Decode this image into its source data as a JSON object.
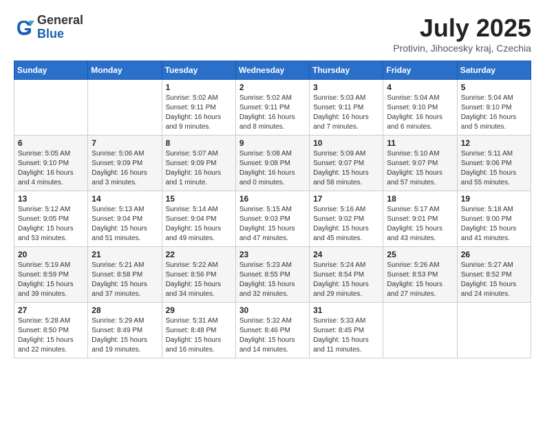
{
  "header": {
    "logo_general": "General",
    "logo_blue": "Blue",
    "month_title": "July 2025",
    "location": "Protivin, Jihocesky kraj, Czechia"
  },
  "days_of_week": [
    "Sunday",
    "Monday",
    "Tuesday",
    "Wednesday",
    "Thursday",
    "Friday",
    "Saturday"
  ],
  "weeks": [
    [
      {
        "day": "",
        "info": ""
      },
      {
        "day": "",
        "info": ""
      },
      {
        "day": "1",
        "info": "Sunrise: 5:02 AM\nSunset: 9:11 PM\nDaylight: 16 hours and 9 minutes."
      },
      {
        "day": "2",
        "info": "Sunrise: 5:02 AM\nSunset: 9:11 PM\nDaylight: 16 hours and 8 minutes."
      },
      {
        "day": "3",
        "info": "Sunrise: 5:03 AM\nSunset: 9:11 PM\nDaylight: 16 hours and 7 minutes."
      },
      {
        "day": "4",
        "info": "Sunrise: 5:04 AM\nSunset: 9:10 PM\nDaylight: 16 hours and 6 minutes."
      },
      {
        "day": "5",
        "info": "Sunrise: 5:04 AM\nSunset: 9:10 PM\nDaylight: 16 hours and 5 minutes."
      }
    ],
    [
      {
        "day": "6",
        "info": "Sunrise: 5:05 AM\nSunset: 9:10 PM\nDaylight: 16 hours and 4 minutes."
      },
      {
        "day": "7",
        "info": "Sunrise: 5:06 AM\nSunset: 9:09 PM\nDaylight: 16 hours and 3 minutes."
      },
      {
        "day": "8",
        "info": "Sunrise: 5:07 AM\nSunset: 9:09 PM\nDaylight: 16 hours and 1 minute."
      },
      {
        "day": "9",
        "info": "Sunrise: 5:08 AM\nSunset: 9:08 PM\nDaylight: 16 hours and 0 minutes."
      },
      {
        "day": "10",
        "info": "Sunrise: 5:09 AM\nSunset: 9:07 PM\nDaylight: 15 hours and 58 minutes."
      },
      {
        "day": "11",
        "info": "Sunrise: 5:10 AM\nSunset: 9:07 PM\nDaylight: 15 hours and 57 minutes."
      },
      {
        "day": "12",
        "info": "Sunrise: 5:11 AM\nSunset: 9:06 PM\nDaylight: 15 hours and 55 minutes."
      }
    ],
    [
      {
        "day": "13",
        "info": "Sunrise: 5:12 AM\nSunset: 9:05 PM\nDaylight: 15 hours and 53 minutes."
      },
      {
        "day": "14",
        "info": "Sunrise: 5:13 AM\nSunset: 9:04 PM\nDaylight: 15 hours and 51 minutes."
      },
      {
        "day": "15",
        "info": "Sunrise: 5:14 AM\nSunset: 9:04 PM\nDaylight: 15 hours and 49 minutes."
      },
      {
        "day": "16",
        "info": "Sunrise: 5:15 AM\nSunset: 9:03 PM\nDaylight: 15 hours and 47 minutes."
      },
      {
        "day": "17",
        "info": "Sunrise: 5:16 AM\nSunset: 9:02 PM\nDaylight: 15 hours and 45 minutes."
      },
      {
        "day": "18",
        "info": "Sunrise: 5:17 AM\nSunset: 9:01 PM\nDaylight: 15 hours and 43 minutes."
      },
      {
        "day": "19",
        "info": "Sunrise: 5:18 AM\nSunset: 9:00 PM\nDaylight: 15 hours and 41 minutes."
      }
    ],
    [
      {
        "day": "20",
        "info": "Sunrise: 5:19 AM\nSunset: 8:59 PM\nDaylight: 15 hours and 39 minutes."
      },
      {
        "day": "21",
        "info": "Sunrise: 5:21 AM\nSunset: 8:58 PM\nDaylight: 15 hours and 37 minutes."
      },
      {
        "day": "22",
        "info": "Sunrise: 5:22 AM\nSunset: 8:56 PM\nDaylight: 15 hours and 34 minutes."
      },
      {
        "day": "23",
        "info": "Sunrise: 5:23 AM\nSunset: 8:55 PM\nDaylight: 15 hours and 32 minutes."
      },
      {
        "day": "24",
        "info": "Sunrise: 5:24 AM\nSunset: 8:54 PM\nDaylight: 15 hours and 29 minutes."
      },
      {
        "day": "25",
        "info": "Sunrise: 5:26 AM\nSunset: 8:53 PM\nDaylight: 15 hours and 27 minutes."
      },
      {
        "day": "26",
        "info": "Sunrise: 5:27 AM\nSunset: 8:52 PM\nDaylight: 15 hours and 24 minutes."
      }
    ],
    [
      {
        "day": "27",
        "info": "Sunrise: 5:28 AM\nSunset: 8:50 PM\nDaylight: 15 hours and 22 minutes."
      },
      {
        "day": "28",
        "info": "Sunrise: 5:29 AM\nSunset: 8:49 PM\nDaylight: 15 hours and 19 minutes."
      },
      {
        "day": "29",
        "info": "Sunrise: 5:31 AM\nSunset: 8:48 PM\nDaylight: 15 hours and 16 minutes."
      },
      {
        "day": "30",
        "info": "Sunrise: 5:32 AM\nSunset: 8:46 PM\nDaylight: 15 hours and 14 minutes."
      },
      {
        "day": "31",
        "info": "Sunrise: 5:33 AM\nSunset: 8:45 PM\nDaylight: 15 hours and 11 minutes."
      },
      {
        "day": "",
        "info": ""
      },
      {
        "day": "",
        "info": ""
      }
    ]
  ]
}
